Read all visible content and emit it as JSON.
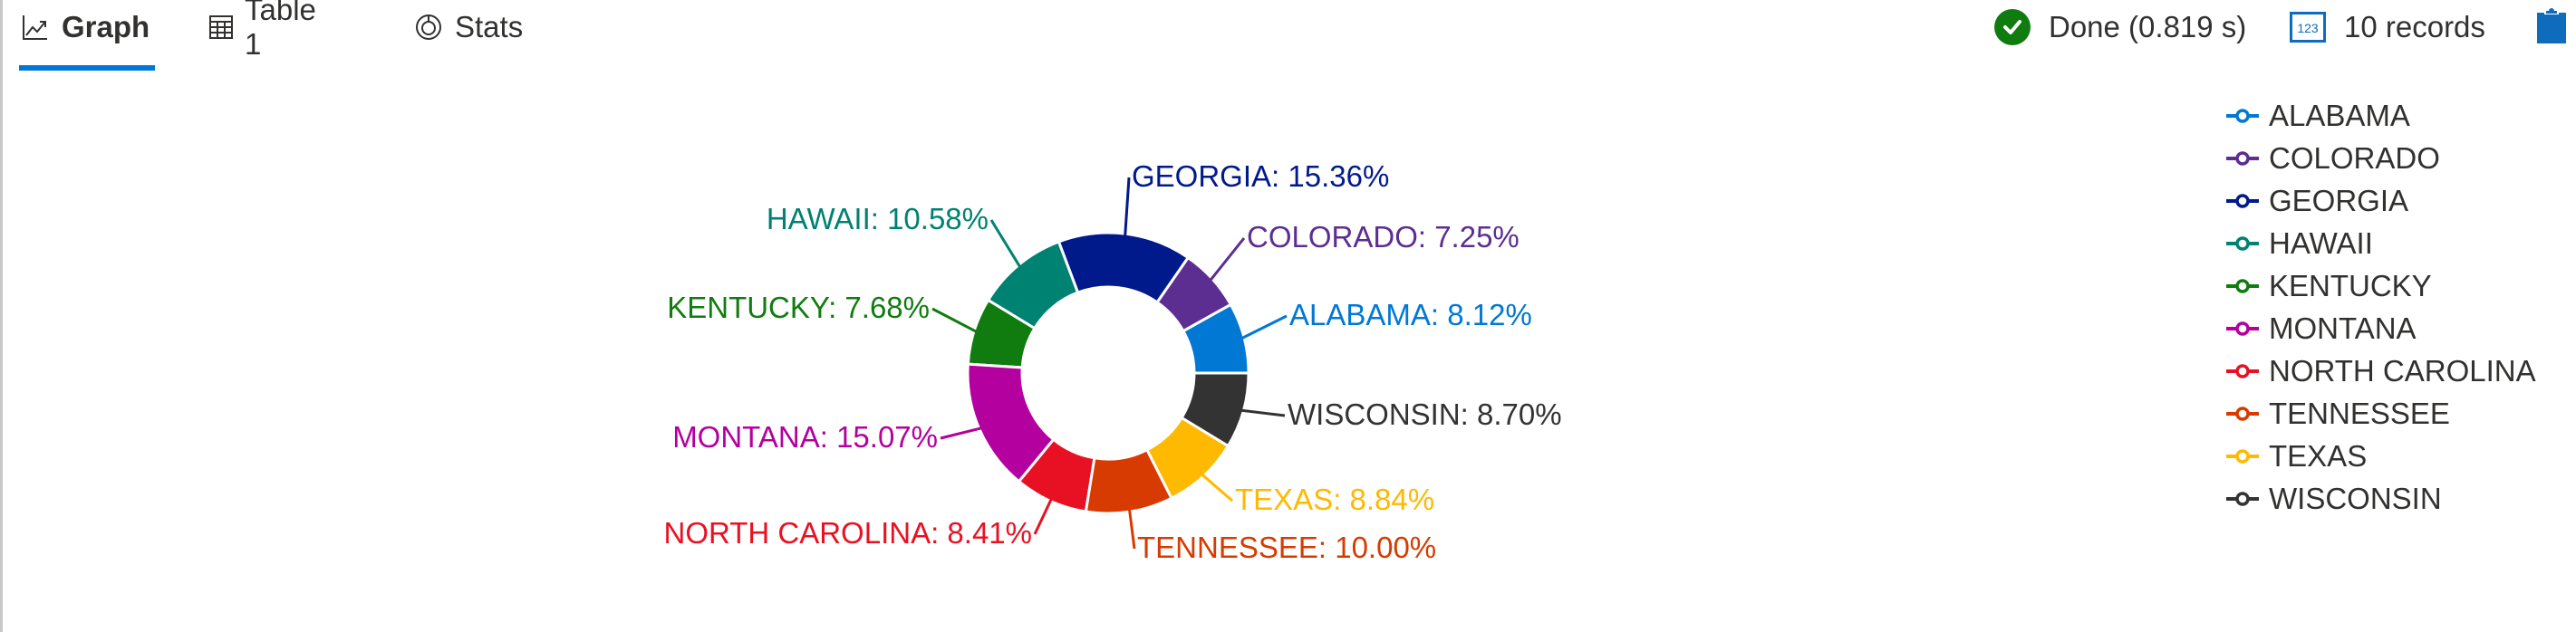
{
  "tabs": [
    {
      "label": "Graph",
      "icon": "line-chart-icon",
      "active": true
    },
    {
      "label": "Table 1",
      "icon": "table-icon",
      "active": false
    },
    {
      "label": "Stats",
      "icon": "stats-icon",
      "active": false
    }
  ],
  "status": {
    "done_label": "Done (0.819 s)",
    "done_icon": "check-circle-icon",
    "done_color": "#107c10",
    "records_label": "10 records",
    "records_icon": "number-badge-icon",
    "records_icon_text": "123",
    "clipboard_icon": "clipboard-icon",
    "accent": "#0f6cbd"
  },
  "chart_data": {
    "type": "pie",
    "donut": true,
    "title": "",
    "legend_position": "right",
    "start_angle": "3 o'clock, counter-clockwise",
    "categories": [
      "ALABAMA",
      "COLORADO",
      "GEORGIA",
      "HAWAII",
      "KENTUCKY",
      "MONTANA",
      "NORTH CAROLINA",
      "TENNESSEE",
      "TEXAS",
      "WISCONSIN"
    ],
    "values": [
      8.12,
      7.25,
      15.36,
      10.58,
      7.68,
      15.07,
      8.41,
      10.0,
      8.84,
      8.7
    ],
    "unit": "%",
    "labels": [
      "ALABAMA: 8.12%",
      "COLORADO: 7.25%",
      "GEORGIA: 15.36%",
      "HAWAII: 10.58%",
      "KENTUCKY: 7.68%",
      "MONTANA: 15.07%",
      "NORTH CAROLINA: 8.41%",
      "TENNESSEE: 10.00%",
      "TEXAS: 8.84%",
      "WISCONSIN: 8.70%"
    ],
    "colors": [
      "#0078d4",
      "#5c2e91",
      "#001a8c",
      "#008272",
      "#107c10",
      "#b4009e",
      "#e81123",
      "#d83b01",
      "#ffb900",
      "#333333"
    ]
  }
}
